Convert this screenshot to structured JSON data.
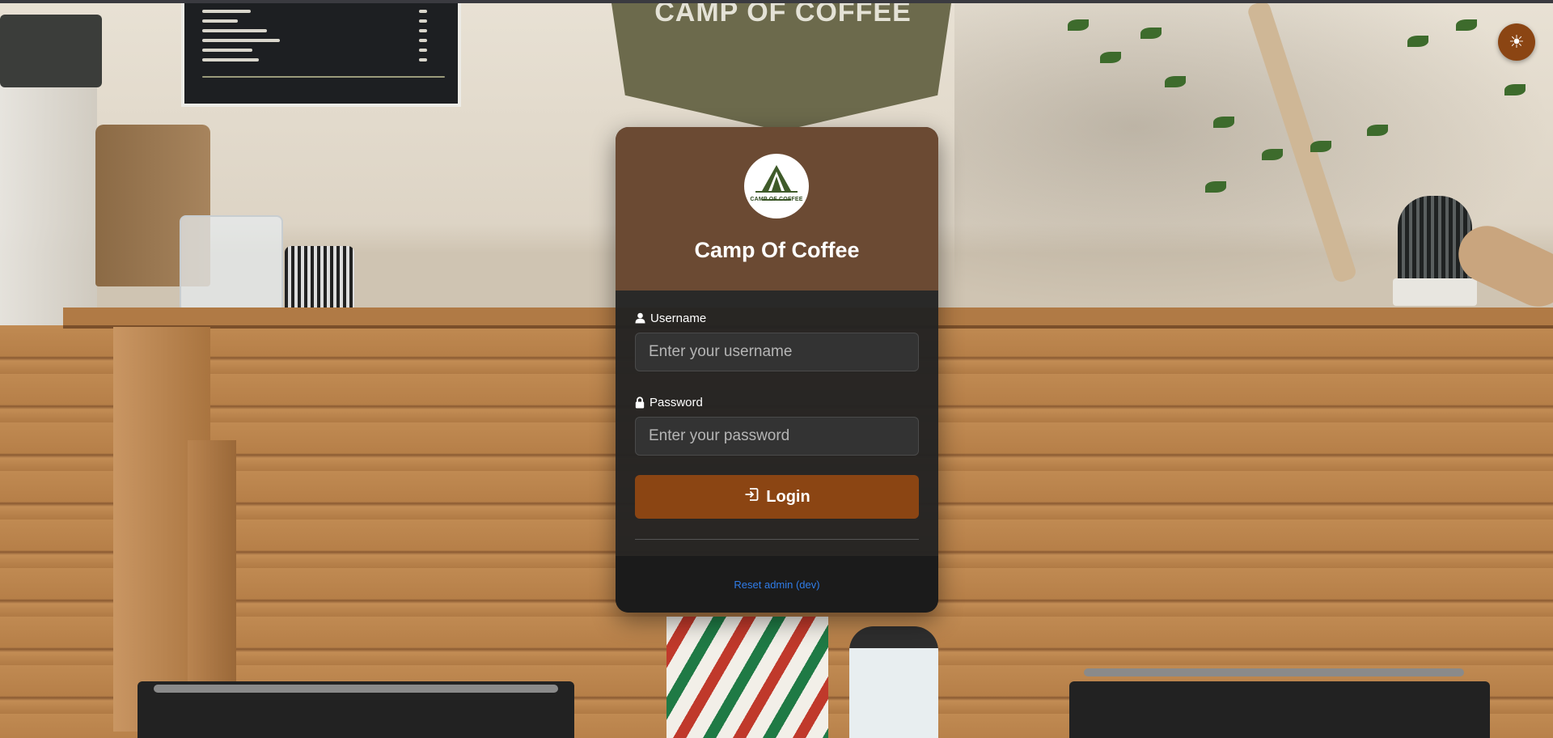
{
  "background": {
    "banner_text": "CAMP OF COFFEE"
  },
  "theme_toggle": {
    "icon": "sun-icon",
    "glyph": "☀"
  },
  "card": {
    "logo": {
      "icon": "tent-logo-icon",
      "text": "CAMP OF COFFEE"
    },
    "title": "Camp Of Coffee",
    "username": {
      "label": "Username",
      "icon": "user-icon",
      "placeholder": "Enter your username",
      "value": ""
    },
    "password": {
      "label": "Password",
      "icon": "lock-icon",
      "placeholder": "Enter your password",
      "value": ""
    },
    "login_button": {
      "label": "Login",
      "icon": "login-arrow-icon"
    },
    "reset_link": "Reset admin (dev)"
  },
  "colors": {
    "header_brown": "#6b4a33",
    "accent_brown": "#8b4513",
    "card_dark": "#222222",
    "input_bg": "#333333",
    "link_blue": "#2f7ce8"
  }
}
